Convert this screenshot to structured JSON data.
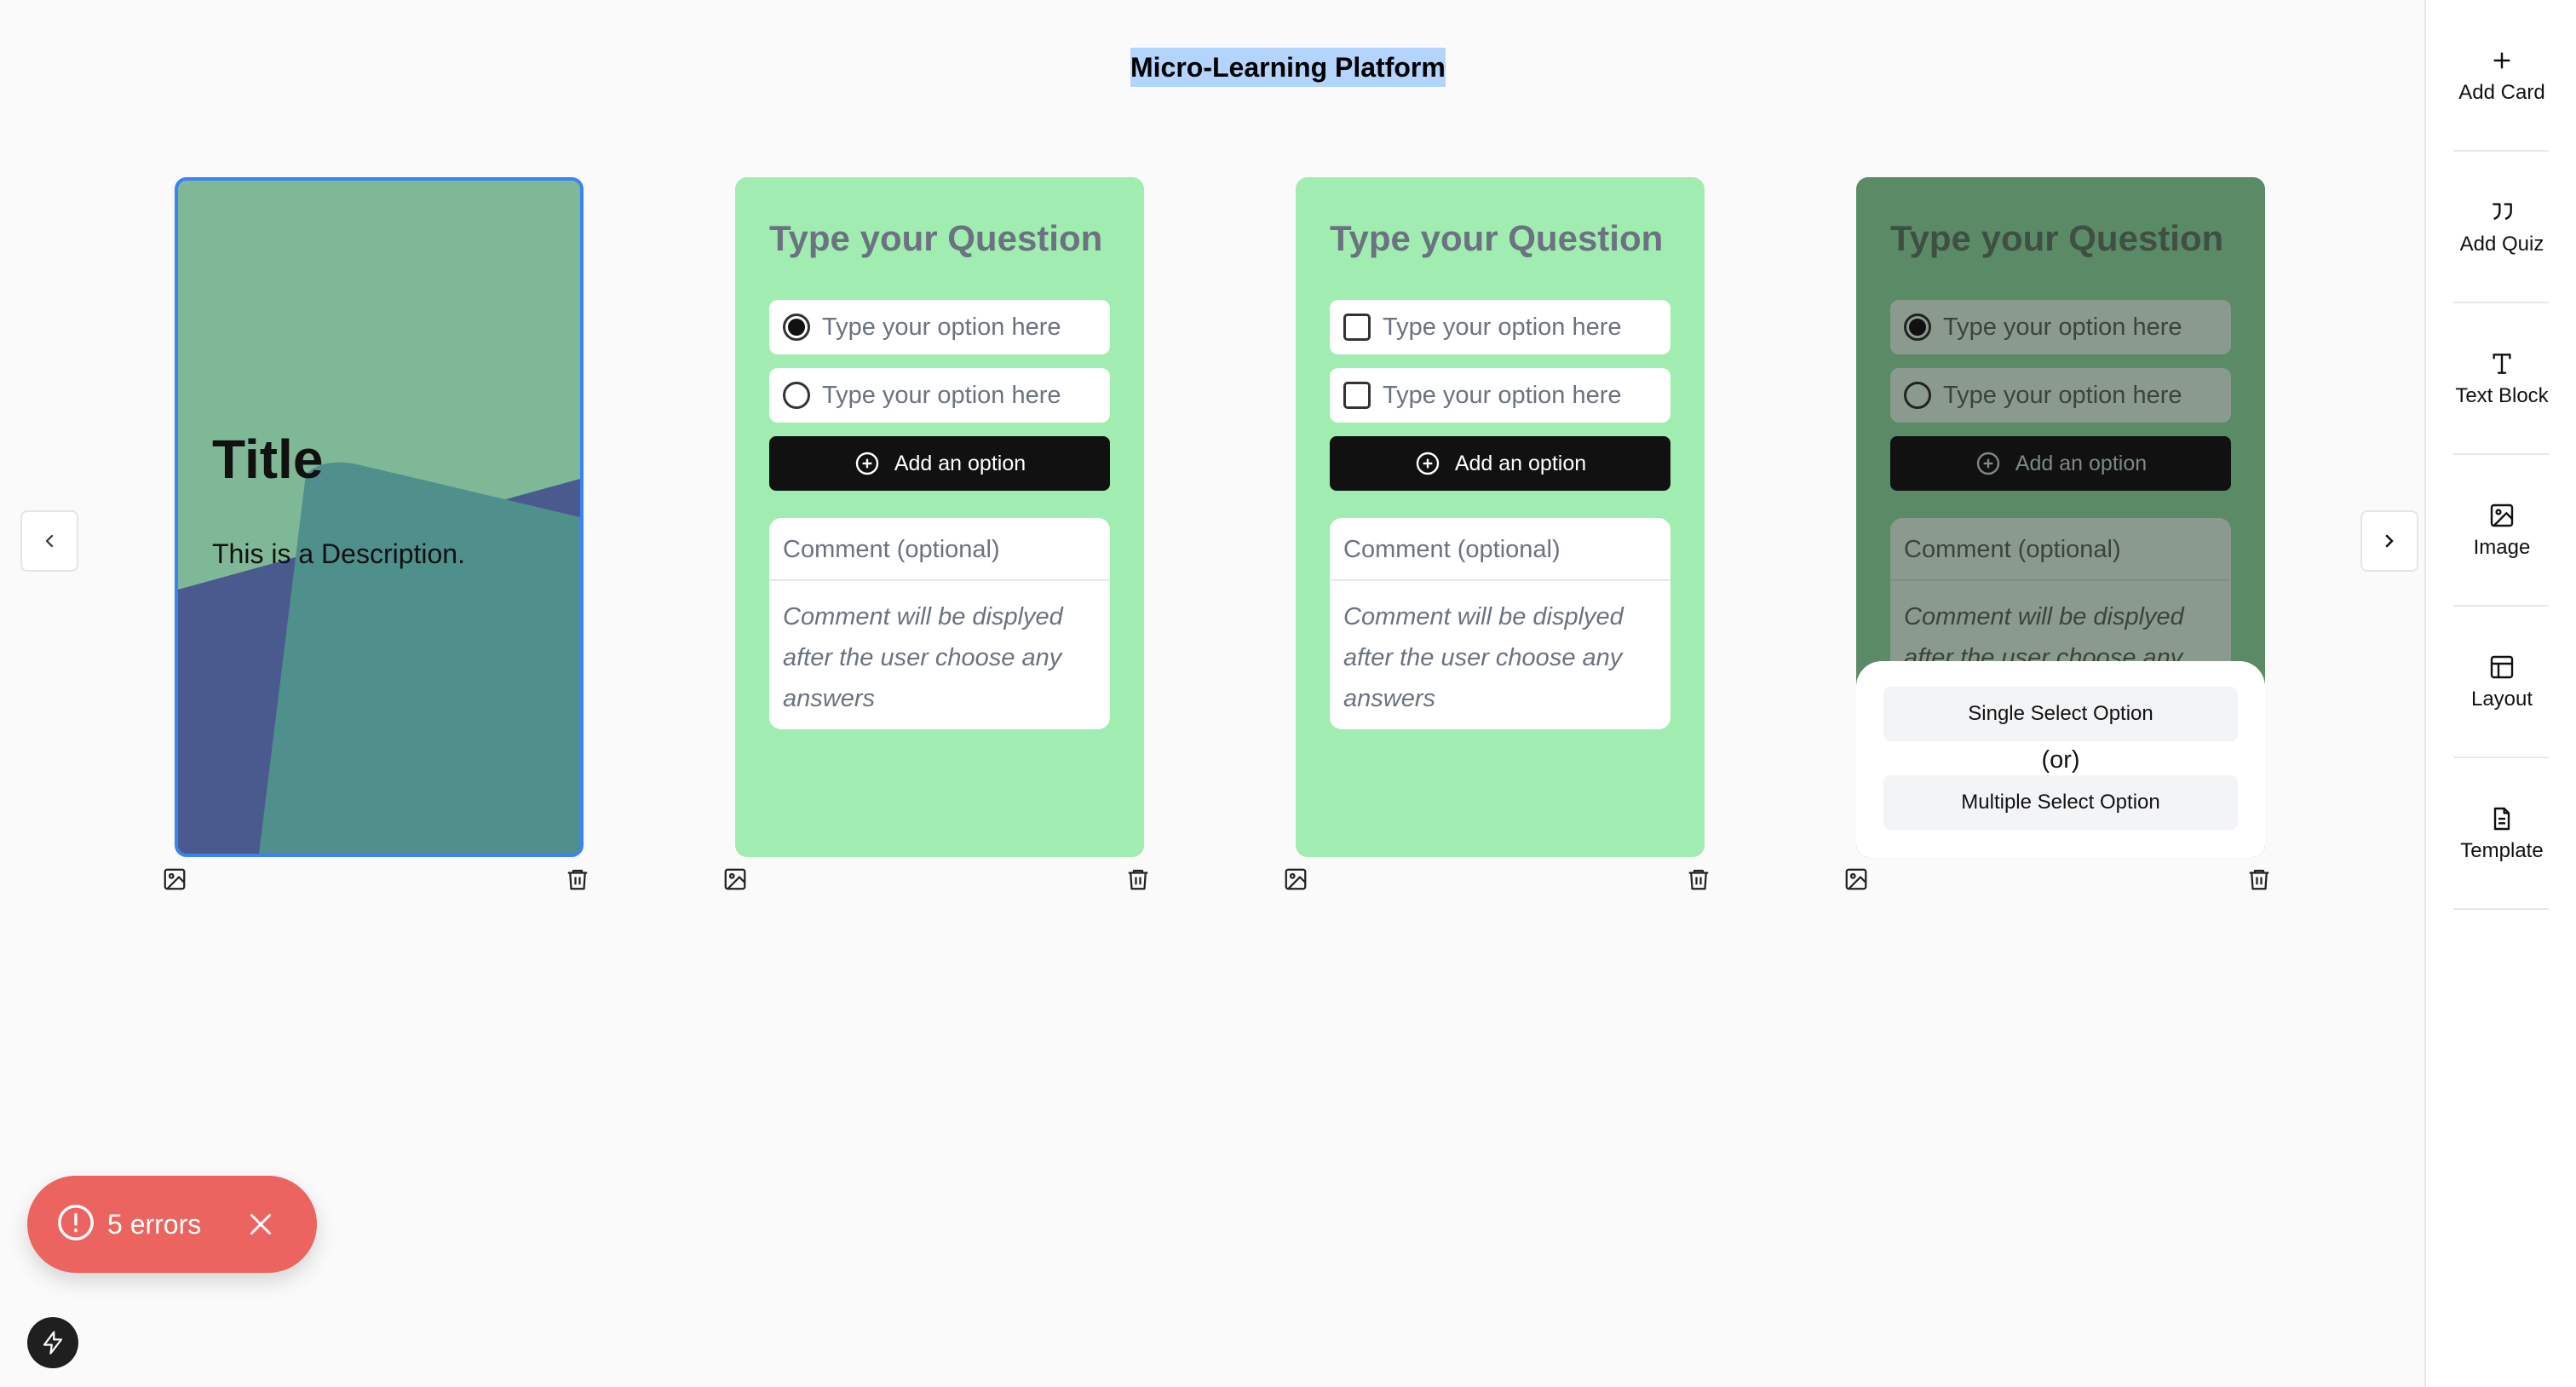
{
  "header": {
    "title": "Micro-Learning Platform"
  },
  "nav": {
    "prev_icon": "chevron-left-icon",
    "next_icon": "chevron-right-icon"
  },
  "cards": [
    {
      "type": "title",
      "title": "Title",
      "description": "This is a Description.",
      "colors": {
        "background": "#7fb896",
        "shape_blue": "#4a5a8f",
        "shape_teal": "#4f8f8c",
        "border": "#3b82f6"
      }
    },
    {
      "type": "quiz-single",
      "question": "Type your Question",
      "options": [
        {
          "placeholder": "Type your option here",
          "selected": true
        },
        {
          "placeholder": "Type your option here",
          "selected": false
        }
      ],
      "add_option_label": "Add an option",
      "comment_label": "Comment (optional)",
      "comment_placeholder": "Comment will be displyed after the user choose any answers",
      "colors": {
        "background": "#a1ecb1"
      }
    },
    {
      "type": "quiz-multiple",
      "question": "Type your Question",
      "options": [
        {
          "placeholder": "Type your option here",
          "checked": false
        },
        {
          "placeholder": "Type your option here",
          "checked": false
        }
      ],
      "add_option_label": "Add an option",
      "comment_label": "Comment (optional)",
      "comment_placeholder": "Comment will be displyed after the user choose any",
      "colors": {
        "background": "#5b8a66"
      }
    },
    {
      "type": "quiz-select-type",
      "question": "Type your Question",
      "options": [
        {
          "placeholder": "Type your option here",
          "selected": true
        },
        {
          "placeholder": "Type your option here",
          "selected": false
        }
      ],
      "add_option_label": "Add an option",
      "comment_label": "Comment (optional)",
      "comment_placeholder": "Comment will be displyed after the user choose any",
      "popup": {
        "single_label": "Single Select Option",
        "or_label": "(or)",
        "multiple_label": "Multiple Select Option"
      }
    }
  ],
  "card_actions": {
    "image_icon": "image-icon",
    "delete_icon": "trash-icon"
  },
  "sidebar": {
    "items": [
      {
        "label": "Add Card",
        "icon": "plus-icon"
      },
      {
        "label": "Add Quiz",
        "icon": "quote-icon"
      },
      {
        "label": "Text Block",
        "icon": "text-icon"
      },
      {
        "label": "Image",
        "icon": "image-icon"
      },
      {
        "label": "Layout",
        "icon": "layout-icon"
      },
      {
        "label": "Template",
        "icon": "file-text-icon"
      }
    ]
  },
  "toast": {
    "error_label": "5 errors",
    "color": "#ec645f"
  },
  "bolt": {
    "icon": "lightning-icon"
  }
}
